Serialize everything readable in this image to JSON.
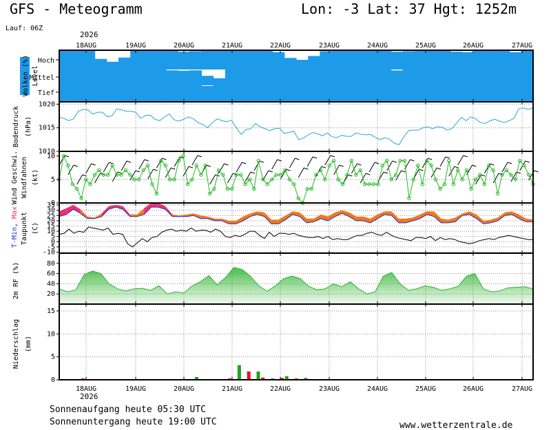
{
  "header": {
    "title": "GFS - Meteogramm",
    "location": "Lon: -3  Lat: 37  Hgt: 1252m",
    "run": "Lauf: 06Z",
    "year": "2026"
  },
  "footer": {
    "sunrise": "Sonnenaufgang heute 05:30 UTC",
    "sunset": "Sonnenuntergang heute 19:00 UTC",
    "site": "www.wetterzentrale.de"
  },
  "colors": {
    "cloud": "#1e9be8",
    "pressure": "#2fa3dc",
    "wind": "#22b922",
    "tmax": "#f0306a",
    "tmin": "#f07818",
    "rh": "#2db22d",
    "precip_red": "#e21818",
    "precip_green": "#22a222"
  },
  "chart_data": [
    {
      "type": "area",
      "panel": "clouds",
      "ylabel_colored": "Wolken (%)",
      "ylabel": "Level",
      "levels": [
        "Hoch",
        "Mittel",
        "Tief"
      ],
      "x": [
        "18AUG",
        "19AUG",
        "20AUG",
        "21AUG",
        "22AUG",
        "23AUG",
        "24AUG",
        "25AUG",
        "26AUG",
        "27AUG"
      ],
      "series": [
        {
          "name": "Hoch",
          "values": [
            100,
            98,
            100,
            55,
            40,
            62,
            100,
            100,
            100,
            100,
            92,
            95,
            100,
            100,
            100,
            100,
            98,
            100,
            90,
            60,
            50,
            70,
            95,
            100,
            100,
            100,
            100,
            98,
            92,
            95,
            100,
            100,
            100,
            92,
            90,
            100,
            98,
            100,
            90,
            100
          ]
        },
        {
          "name": "Mittel",
          "values": [
            100,
            100,
            100,
            100,
            100,
            100,
            100,
            100,
            100,
            95,
            92,
            95,
            60,
            45,
            100,
            100,
            100,
            100,
            100,
            100,
            100,
            100,
            100,
            100,
            100,
            100,
            100,
            100,
            94,
            100,
            100,
            100,
            100,
            100,
            100,
            100,
            100,
            100,
            100,
            100
          ]
        },
        {
          "name": "Tief",
          "values": [
            100,
            100,
            100,
            100,
            100,
            100,
            100,
            100,
            100,
            100,
            100,
            100,
            96,
            100,
            100,
            100,
            100,
            100,
            100,
            100,
            100,
            100,
            100,
            100,
            100,
            100,
            100,
            100,
            100,
            100,
            100,
            100,
            100,
            100,
            100,
            100,
            100,
            100,
            100,
            100
          ]
        }
      ]
    },
    {
      "type": "line",
      "panel": "pressure",
      "title": "Bodendruck",
      "ylabel": "(hPa)",
      "yticks": [
        1010,
        1015,
        1020
      ],
      "ylim": [
        1010,
        1020.5
      ],
      "series": [
        {
          "values": [
            1017.2,
            1017.0,
            1016.5,
            1016.9,
            1018.5,
            1018.9,
            1018.8,
            1017.9,
            1018.3,
            1018.3,
            1017.4,
            1017.5,
            1019.0,
            1018.8,
            1018.5,
            1018.5,
            1018.3,
            1017.0,
            1017.6,
            1017.7,
            1016.8,
            1016.5,
            1017.3,
            1017.9,
            1016.7,
            1016.4,
            1016.8,
            1017.3,
            1016.9,
            1016.1,
            1015.7,
            1015.0,
            1016.1,
            1016.9,
            1016.5,
            1016.3,
            1016.6,
            1015.0,
            1013.6,
            1014.6,
            1014.8,
            1015.9,
            1015.2,
            1014.8,
            1014.4,
            1014.8,
            1014.9,
            1013.8,
            1014.0,
            1014.3,
            1012.5,
            1012.8,
            1013.5,
            1014.0,
            1013.7,
            1013.3,
            1013.9,
            1013.1,
            1012.9,
            1013.4,
            1013.2,
            1013.2,
            1013.9,
            1013.6,
            1013.5,
            1013.6,
            1013.0,
            1012.5,
            1012.9,
            1012.6,
            1011.7,
            1011.4,
            1013.1,
            1014.4,
            1014.5,
            1014.5,
            1015.0,
            1015.2,
            1014.8,
            1015.2,
            1015.1,
            1014.5,
            1014.8,
            1016.0,
            1017.2,
            1016.5,
            1017.3,
            1016.9,
            1016.1,
            1015.9,
            1016.5,
            1016.8,
            1016.4,
            1016.1,
            1016.5,
            1017.0,
            1019.0,
            1019.2,
            1018.9,
            1019.2
          ]
        }
      ]
    },
    {
      "type": "line",
      "panel": "wind",
      "title_colored": "Wind Geschwi.",
      "title": "Windfahnen",
      "ylabel": "(kt)",
      "yticks": [
        0,
        5,
        10
      ],
      "ylim": [
        0,
        11
      ],
      "series": [
        {
          "values": [
            5,
            10,
            8,
            4,
            3,
            1,
            5,
            4,
            6,
            7,
            6,
            6,
            8,
            6,
            6,
            7,
            6,
            5,
            5,
            7,
            8,
            4,
            2,
            9,
            8,
            5,
            5,
            9,
            10,
            4,
            5,
            8,
            6,
            8,
            2,
            3,
            7,
            6,
            3,
            3,
            6,
            6,
            4,
            5,
            3,
            9,
            5,
            4,
            5,
            6,
            6,
            7,
            5,
            4,
            1,
            0,
            3,
            3,
            6,
            7,
            5,
            8,
            9,
            5,
            4,
            6,
            9,
            6,
            7,
            4,
            4,
            4,
            4,
            8,
            9,
            5,
            6,
            9,
            9,
            1,
            5,
            8,
            4,
            9,
            8,
            5,
            3,
            4,
            9,
            4,
            7,
            5,
            7,
            3,
            5,
            6,
            4,
            8,
            7,
            2,
            6,
            7,
            6,
            5,
            9,
            8,
            6,
            4
          ]
        }
      ]
    },
    {
      "type": "area",
      "panel": "temperature",
      "title_colored_min": "T-Min",
      "title_colored_max": "Max",
      "title": "Taupunkt",
      "ylabel": "(C)",
      "yticks": [
        -10,
        -5,
        0,
        5,
        10,
        15,
        20,
        25,
        30,
        35
      ],
      "ylim": [
        -11,
        37
      ],
      "series": [
        {
          "name": "T-Min",
          "values": [
            24,
            26,
            31,
            27,
            22,
            22,
            24,
            31,
            33,
            31,
            24,
            24,
            26,
            33,
            33,
            31,
            24,
            24,
            24,
            25,
            22,
            22,
            20,
            20,
            17,
            17,
            20,
            24,
            26,
            24,
            17,
            17,
            21,
            26,
            24,
            18,
            19,
            22,
            20,
            24,
            27,
            24,
            20,
            20,
            18,
            22,
            26,
            25,
            18,
            18,
            20,
            22,
            26,
            24,
            18,
            18,
            19,
            25,
            26,
            22,
            17,
            18,
            20,
            25,
            26,
            22,
            19,
            19
          ]
        },
        {
          "name": "T-Max",
          "values": [
            29,
            32,
            35,
            31,
            24,
            23,
            27,
            34,
            35,
            34,
            26,
            26,
            32,
            37,
            37,
            34,
            26,
            25,
            26,
            27,
            25,
            24,
            22,
            22,
            20,
            20,
            24,
            27,
            29,
            28,
            21,
            21,
            25,
            29,
            28,
            22,
            22,
            26,
            24,
            28,
            30,
            28,
            24,
            24,
            22,
            26,
            29,
            29,
            22,
            22,
            23,
            26,
            29,
            29,
            22,
            21,
            23,
            27,
            29,
            26,
            20,
            21,
            23,
            28,
            29,
            26,
            22,
            21
          ]
        },
        {
          "name": "Taupunkt",
          "values": [
            7,
            8,
            12,
            8,
            10,
            9,
            14,
            13,
            12,
            11,
            13,
            7,
            8,
            7,
            -2,
            -5,
            -1,
            3,
            0,
            4,
            5,
            9,
            11,
            12,
            10,
            11,
            10,
            13,
            10,
            11,
            11,
            9,
            12,
            10,
            5,
            4,
            6,
            5,
            7,
            10,
            10,
            6,
            3,
            9,
            5,
            8,
            8,
            7,
            8,
            6,
            5,
            4,
            4,
            5,
            3,
            5,
            2,
            3,
            2,
            2,
            4,
            6,
            6,
            8,
            9,
            7,
            6,
            9,
            6,
            4,
            3,
            2,
            1,
            4,
            4,
            3,
            5,
            1,
            4,
            2,
            3,
            2,
            0,
            -1,
            -2,
            -1,
            1,
            2,
            3,
            2,
            4,
            5,
            6,
            5,
            4,
            3,
            2,
            2
          ]
        }
      ]
    },
    {
      "type": "area",
      "panel": "humidity",
      "title": "2m RF (%)",
      "yticks": [
        20,
        40,
        60,
        80
      ],
      "ylim": [
        0,
        100
      ],
      "series": [
        {
          "values": [
            30,
            24,
            28,
            58,
            65,
            60,
            40,
            30,
            26,
            30,
            31,
            27,
            36,
            20,
            24,
            22,
            36,
            44,
            56,
            38,
            52,
            72,
            68,
            55,
            36,
            25,
            36,
            50,
            55,
            50,
            35,
            28,
            30,
            40,
            34,
            44,
            30,
            20,
            24,
            55,
            62,
            40,
            27,
            30,
            36,
            33,
            27,
            30,
            35,
            55,
            60,
            30,
            24,
            26,
            32,
            33,
            34,
            30
          ]
        }
      ]
    },
    {
      "type": "bar",
      "panel": "precipitation",
      "title": "Niederschlag",
      "ylabel": "(mm)",
      "yticks": [
        0,
        5,
        10,
        15
      ],
      "ylim": [
        0,
        16.5
      ],
      "series": [
        {
          "name": "red",
          "bars": [
            [
              0.05,
              0.3
            ],
            [
              0.33,
              0.1
            ],
            [
              0.36,
              0.3
            ],
            [
              0.4,
              1.8
            ],
            [
              0.43,
              0.5
            ],
            [
              0.47,
              0.4
            ],
            [
              0.5,
              0.3
            ]
          ]
        },
        {
          "name": "green",
          "bars": [
            [
              0.29,
              0.6
            ],
            [
              0.38,
              3.2
            ],
            [
              0.42,
              1.8
            ],
            [
              0.45,
              0.3
            ],
            [
              0.48,
              0.8
            ],
            [
              0.52,
              0.4
            ]
          ]
        }
      ]
    }
  ],
  "xaxis": {
    "labels": [
      "18AUG",
      "19AUG",
      "20AUG",
      "21AUG",
      "22AUG",
      "23AUG",
      "24AUG",
      "25AUG",
      "26AUG",
      "27AUG"
    ]
  }
}
